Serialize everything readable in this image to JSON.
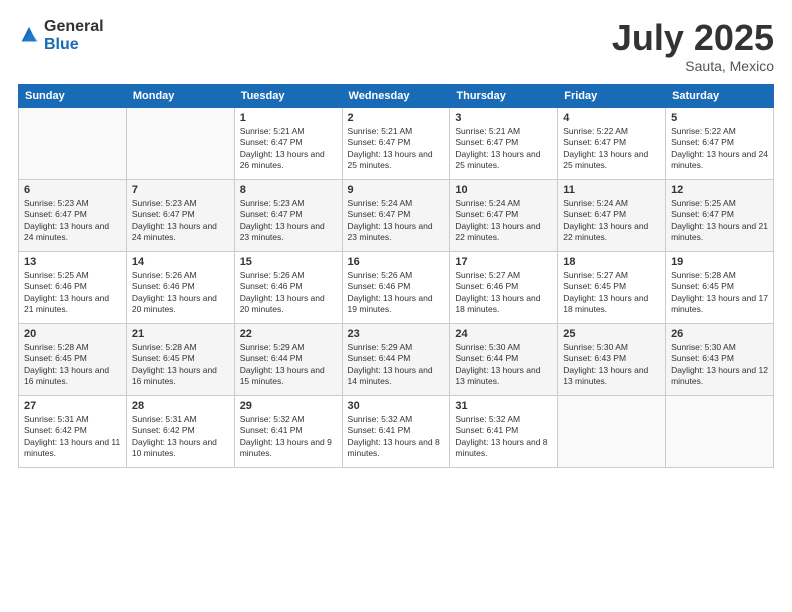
{
  "logo": {
    "general": "General",
    "blue": "Blue"
  },
  "title": {
    "month_year": "July 2025",
    "location": "Sauta, Mexico"
  },
  "weekdays": [
    "Sunday",
    "Monday",
    "Tuesday",
    "Wednesday",
    "Thursday",
    "Friday",
    "Saturday"
  ],
  "weeks": [
    [
      {
        "day": "",
        "sunrise": "",
        "sunset": "",
        "daylight": ""
      },
      {
        "day": "",
        "sunrise": "",
        "sunset": "",
        "daylight": ""
      },
      {
        "day": "1",
        "sunrise": "Sunrise: 5:21 AM",
        "sunset": "Sunset: 6:47 PM",
        "daylight": "Daylight: 13 hours and 26 minutes."
      },
      {
        "day": "2",
        "sunrise": "Sunrise: 5:21 AM",
        "sunset": "Sunset: 6:47 PM",
        "daylight": "Daylight: 13 hours and 25 minutes."
      },
      {
        "day": "3",
        "sunrise": "Sunrise: 5:21 AM",
        "sunset": "Sunset: 6:47 PM",
        "daylight": "Daylight: 13 hours and 25 minutes."
      },
      {
        "day": "4",
        "sunrise": "Sunrise: 5:22 AM",
        "sunset": "Sunset: 6:47 PM",
        "daylight": "Daylight: 13 hours and 25 minutes."
      },
      {
        "day": "5",
        "sunrise": "Sunrise: 5:22 AM",
        "sunset": "Sunset: 6:47 PM",
        "daylight": "Daylight: 13 hours and 24 minutes."
      }
    ],
    [
      {
        "day": "6",
        "sunrise": "Sunrise: 5:23 AM",
        "sunset": "Sunset: 6:47 PM",
        "daylight": "Daylight: 13 hours and 24 minutes."
      },
      {
        "day": "7",
        "sunrise": "Sunrise: 5:23 AM",
        "sunset": "Sunset: 6:47 PM",
        "daylight": "Daylight: 13 hours and 24 minutes."
      },
      {
        "day": "8",
        "sunrise": "Sunrise: 5:23 AM",
        "sunset": "Sunset: 6:47 PM",
        "daylight": "Daylight: 13 hours and 23 minutes."
      },
      {
        "day": "9",
        "sunrise": "Sunrise: 5:24 AM",
        "sunset": "Sunset: 6:47 PM",
        "daylight": "Daylight: 13 hours and 23 minutes."
      },
      {
        "day": "10",
        "sunrise": "Sunrise: 5:24 AM",
        "sunset": "Sunset: 6:47 PM",
        "daylight": "Daylight: 13 hours and 22 minutes."
      },
      {
        "day": "11",
        "sunrise": "Sunrise: 5:24 AM",
        "sunset": "Sunset: 6:47 PM",
        "daylight": "Daylight: 13 hours and 22 minutes."
      },
      {
        "day": "12",
        "sunrise": "Sunrise: 5:25 AM",
        "sunset": "Sunset: 6:47 PM",
        "daylight": "Daylight: 13 hours and 21 minutes."
      }
    ],
    [
      {
        "day": "13",
        "sunrise": "Sunrise: 5:25 AM",
        "sunset": "Sunset: 6:46 PM",
        "daylight": "Daylight: 13 hours and 21 minutes."
      },
      {
        "day": "14",
        "sunrise": "Sunrise: 5:26 AM",
        "sunset": "Sunset: 6:46 PM",
        "daylight": "Daylight: 13 hours and 20 minutes."
      },
      {
        "day": "15",
        "sunrise": "Sunrise: 5:26 AM",
        "sunset": "Sunset: 6:46 PM",
        "daylight": "Daylight: 13 hours and 20 minutes."
      },
      {
        "day": "16",
        "sunrise": "Sunrise: 5:26 AM",
        "sunset": "Sunset: 6:46 PM",
        "daylight": "Daylight: 13 hours and 19 minutes."
      },
      {
        "day": "17",
        "sunrise": "Sunrise: 5:27 AM",
        "sunset": "Sunset: 6:46 PM",
        "daylight": "Daylight: 13 hours and 18 minutes."
      },
      {
        "day": "18",
        "sunrise": "Sunrise: 5:27 AM",
        "sunset": "Sunset: 6:45 PM",
        "daylight": "Daylight: 13 hours and 18 minutes."
      },
      {
        "day": "19",
        "sunrise": "Sunrise: 5:28 AM",
        "sunset": "Sunset: 6:45 PM",
        "daylight": "Daylight: 13 hours and 17 minutes."
      }
    ],
    [
      {
        "day": "20",
        "sunrise": "Sunrise: 5:28 AM",
        "sunset": "Sunset: 6:45 PM",
        "daylight": "Daylight: 13 hours and 16 minutes."
      },
      {
        "day": "21",
        "sunrise": "Sunrise: 5:28 AM",
        "sunset": "Sunset: 6:45 PM",
        "daylight": "Daylight: 13 hours and 16 minutes."
      },
      {
        "day": "22",
        "sunrise": "Sunrise: 5:29 AM",
        "sunset": "Sunset: 6:44 PM",
        "daylight": "Daylight: 13 hours and 15 minutes."
      },
      {
        "day": "23",
        "sunrise": "Sunrise: 5:29 AM",
        "sunset": "Sunset: 6:44 PM",
        "daylight": "Daylight: 13 hours and 14 minutes."
      },
      {
        "day": "24",
        "sunrise": "Sunrise: 5:30 AM",
        "sunset": "Sunset: 6:44 PM",
        "daylight": "Daylight: 13 hours and 13 minutes."
      },
      {
        "day": "25",
        "sunrise": "Sunrise: 5:30 AM",
        "sunset": "Sunset: 6:43 PM",
        "daylight": "Daylight: 13 hours and 13 minutes."
      },
      {
        "day": "26",
        "sunrise": "Sunrise: 5:30 AM",
        "sunset": "Sunset: 6:43 PM",
        "daylight": "Daylight: 13 hours and 12 minutes."
      }
    ],
    [
      {
        "day": "27",
        "sunrise": "Sunrise: 5:31 AM",
        "sunset": "Sunset: 6:42 PM",
        "daylight": "Daylight: 13 hours and 11 minutes."
      },
      {
        "day": "28",
        "sunrise": "Sunrise: 5:31 AM",
        "sunset": "Sunset: 6:42 PM",
        "daylight": "Daylight: 13 hours and 10 minutes."
      },
      {
        "day": "29",
        "sunrise": "Sunrise: 5:32 AM",
        "sunset": "Sunset: 6:41 PM",
        "daylight": "Daylight: 13 hours and 9 minutes."
      },
      {
        "day": "30",
        "sunrise": "Sunrise: 5:32 AM",
        "sunset": "Sunset: 6:41 PM",
        "daylight": "Daylight: 13 hours and 8 minutes."
      },
      {
        "day": "31",
        "sunrise": "Sunrise: 5:32 AM",
        "sunset": "Sunset: 6:41 PM",
        "daylight": "Daylight: 13 hours and 8 minutes."
      },
      {
        "day": "",
        "sunrise": "",
        "sunset": "",
        "daylight": ""
      },
      {
        "day": "",
        "sunrise": "",
        "sunset": "",
        "daylight": ""
      }
    ]
  ]
}
